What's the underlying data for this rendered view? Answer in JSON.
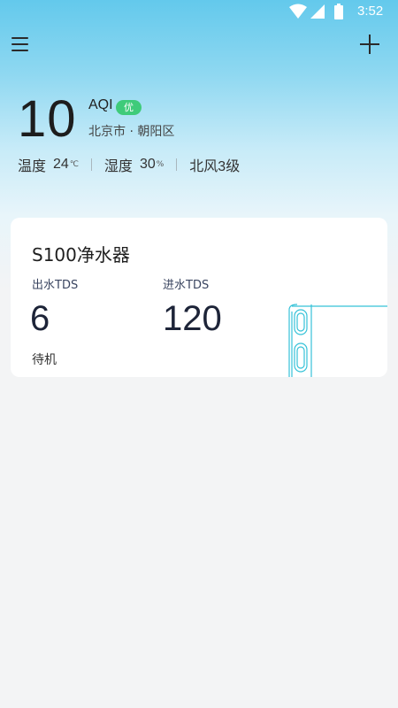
{
  "status_bar": {
    "time": "3:52"
  },
  "aqi": {
    "value": "10",
    "label": "AQI",
    "quality": "优",
    "location": "北京市 · 朝阳区",
    "badge_color": "#3fcb7a"
  },
  "weather": {
    "temp_label": "温度",
    "temp_value": "24",
    "temp_unit": "℃",
    "humidity_label": "湿度",
    "humidity_value": "30",
    "humidity_unit": "%",
    "wind": "北风3级"
  },
  "device": {
    "name": "S100净水器",
    "out_label": "出水TDS",
    "out_value": "6",
    "in_label": "进水TDS",
    "in_value": "120",
    "status": "待机"
  },
  "icons": {
    "menu": "hamburger-menu-icon",
    "add": "plus-icon",
    "wifi": "wifi-icon",
    "signal": "cell-signal-icon",
    "battery": "battery-icon"
  },
  "colors": {
    "accent": "#63c9ec",
    "illustration": "#35c2d8"
  }
}
